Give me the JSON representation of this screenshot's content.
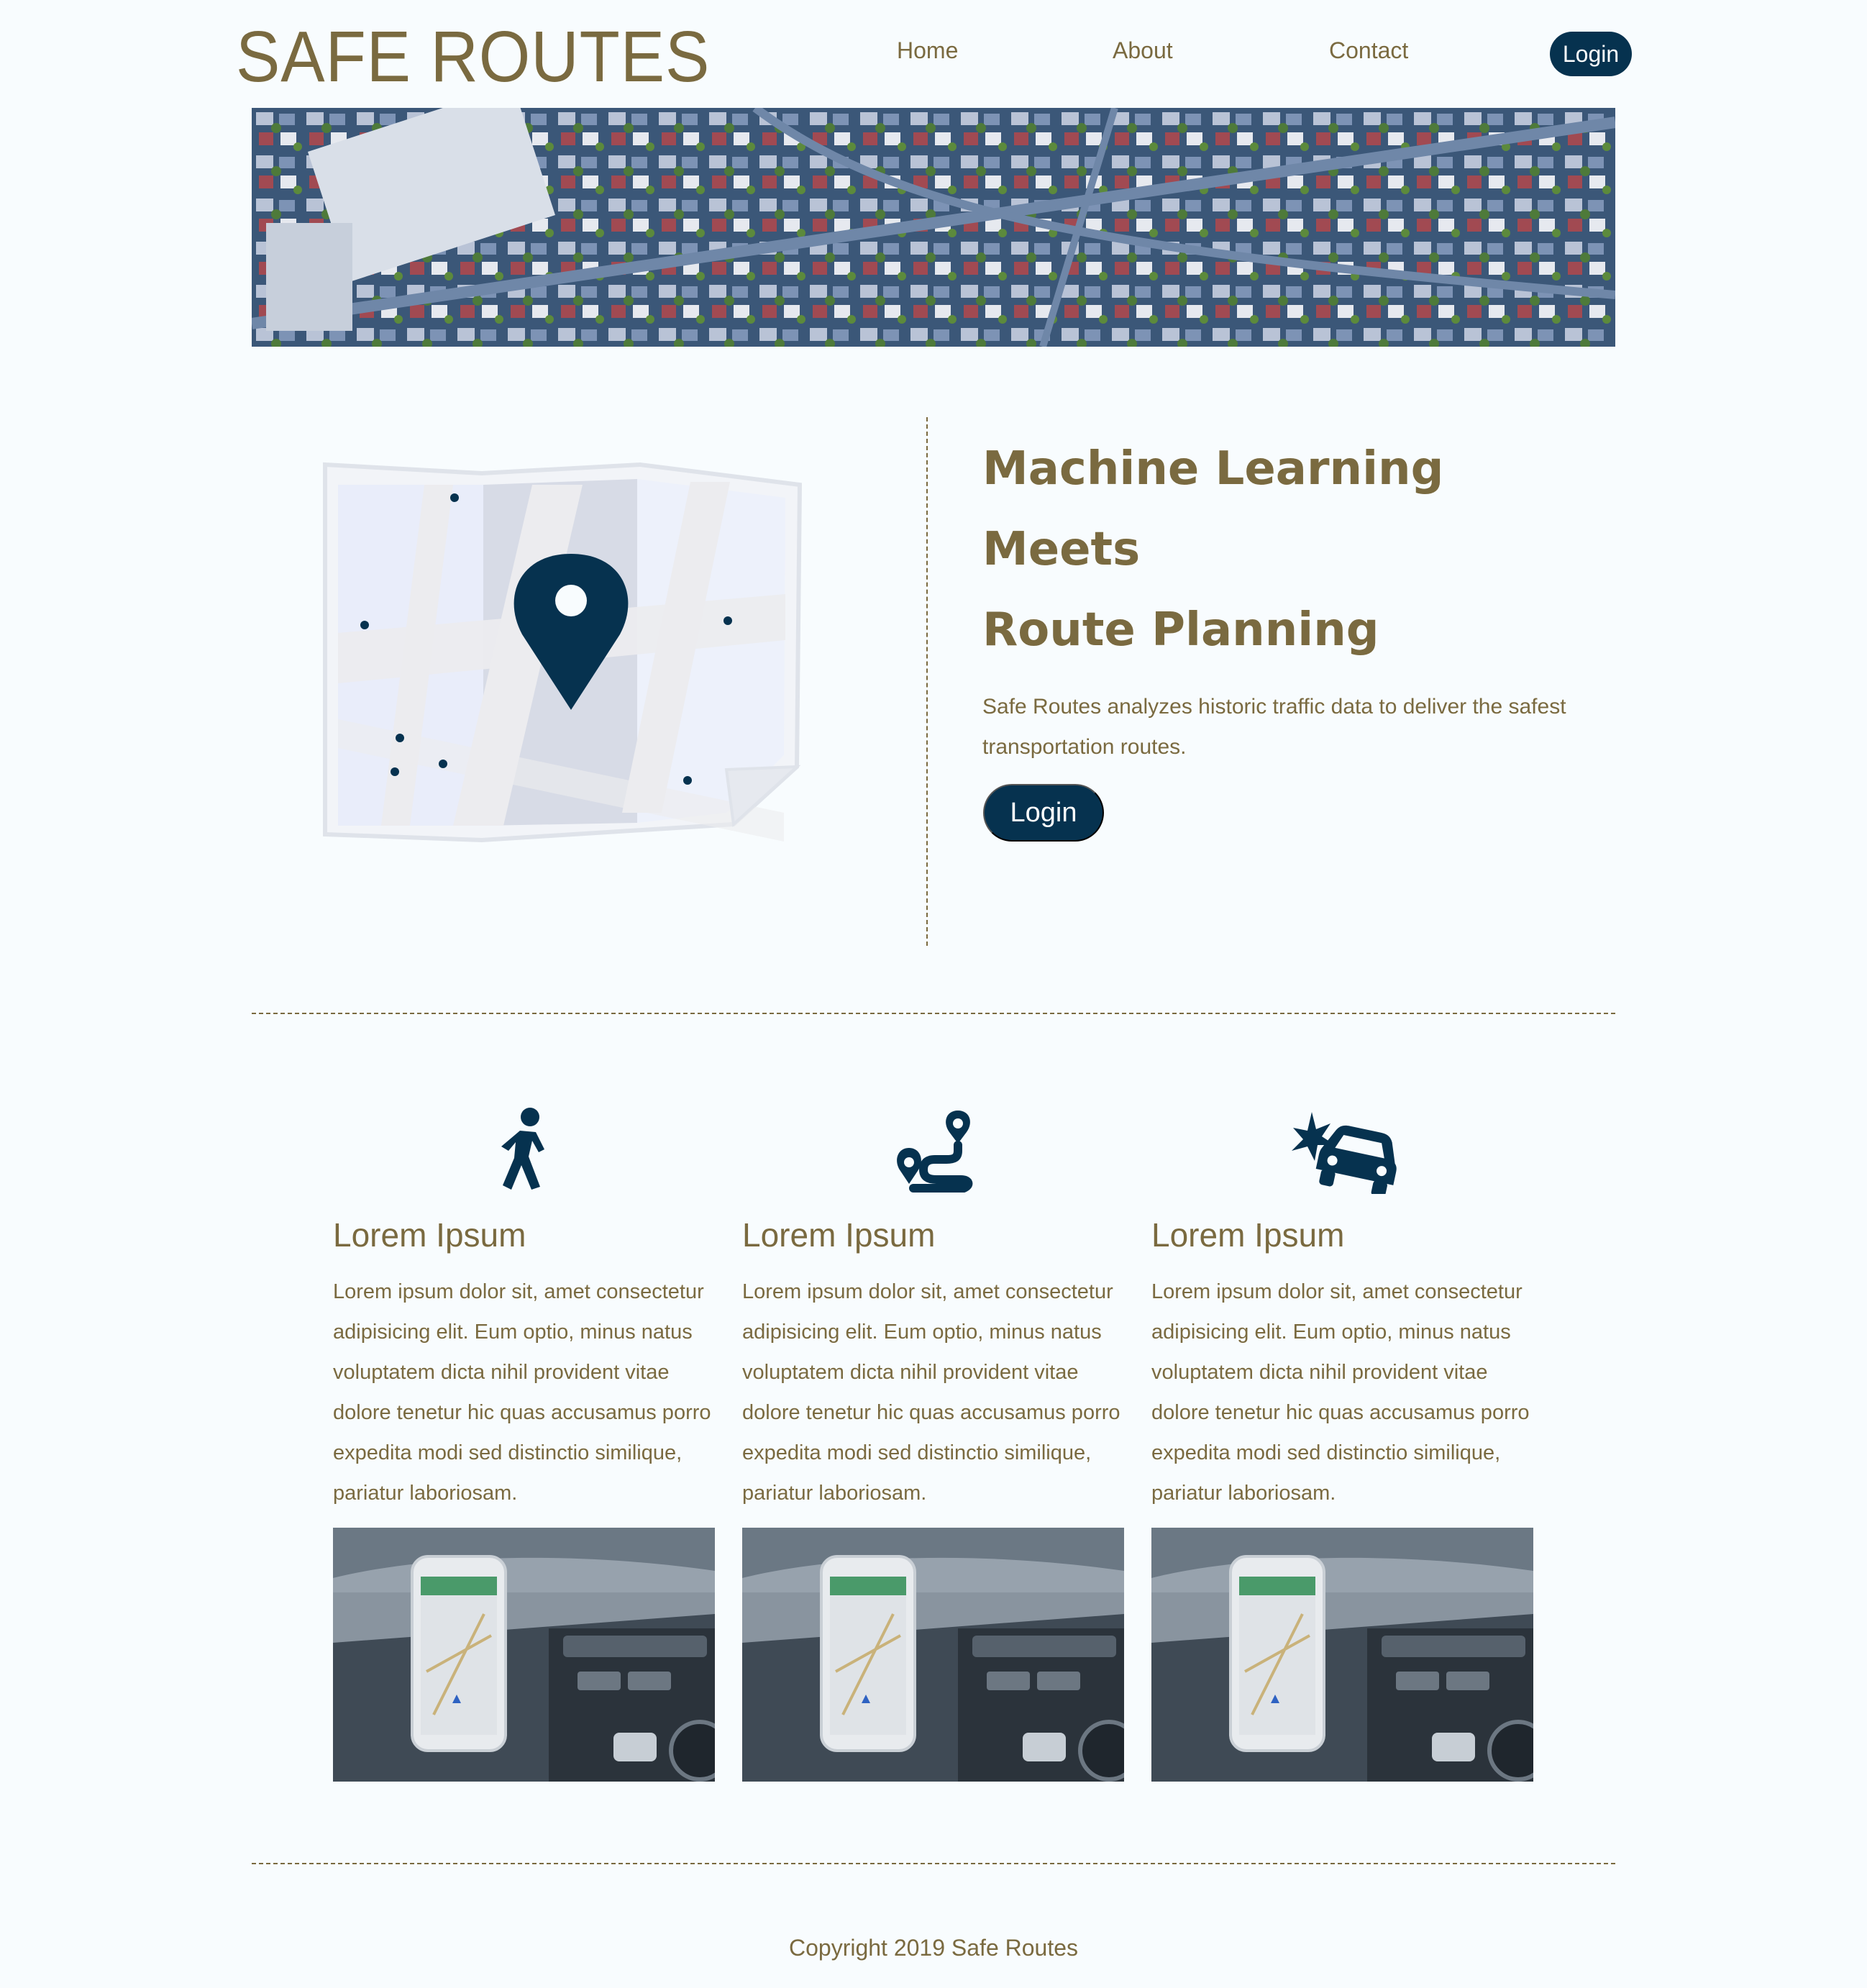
{
  "header": {
    "logo": "SAFE ROUTES",
    "nav": [
      {
        "label": "Home"
      },
      {
        "label": "About"
      },
      {
        "label": "Contact"
      }
    ],
    "login_label": "Login"
  },
  "hero": {
    "headline": [
      "Machine Learning",
      "Meets",
      "Route Planning"
    ],
    "description": "Safe Routes analyzes historic traffic data to deliver the safest transportation routes.",
    "login_label": "Login"
  },
  "features": [
    {
      "icon": "pedestrian-icon",
      "title": "Lorem Ipsum",
      "text": "Lorem ipsum dolor sit, amet consectetur adipisicing elit. Eum optio, minus natus voluptatem dicta nihil provident vitae dolore tenetur hic quas accusamus porro expedita modi sed distinctio similique, pariatur laboriosam."
    },
    {
      "icon": "route-icon",
      "title": "Lorem Ipsum",
      "text": "Lorem ipsum dolor sit, amet consectetur adipisicing elit. Eum optio, minus natus voluptatem dicta nihil provident vitae dolore tenetur hic quas accusamus porro expedita modi sed distinctio similique, pariatur laboriosam."
    },
    {
      "icon": "car-crash-icon",
      "title": "Lorem Ipsum",
      "text": "Lorem ipsum dolor sit, amet consectetur adipisicing elit. Eum optio, minus natus voluptatem dicta nihil provident vitae dolore tenetur hic quas accusamus porro expedita modi sed distinctio similique, pariatur laboriosam."
    }
  ],
  "footer": {
    "copyright": "Copyright 2019 Safe Routes"
  },
  "colors": {
    "brand_text": "#7a6a40",
    "accent": "#06324f",
    "background": "#f8fcfe"
  }
}
